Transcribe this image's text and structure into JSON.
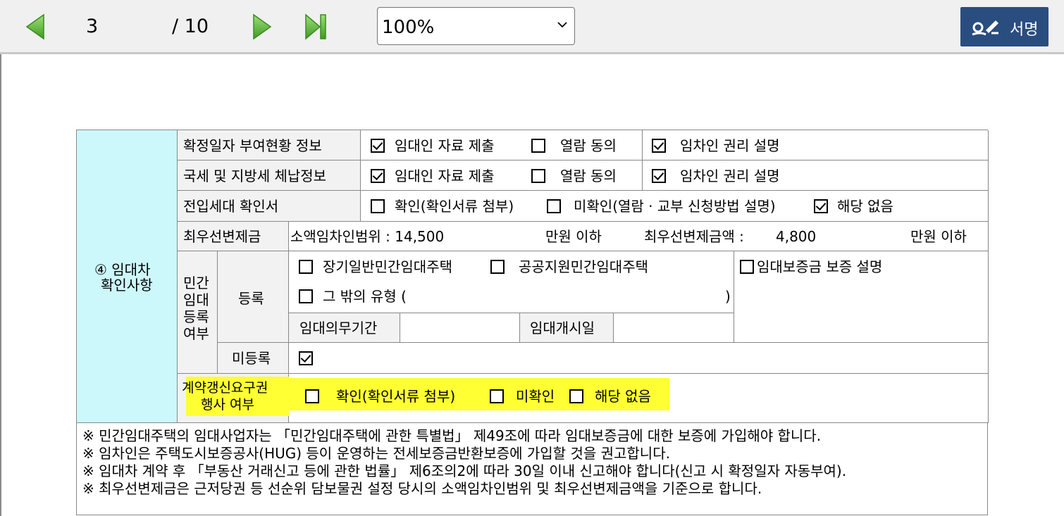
{
  "toolbar": {
    "prev_icon": "triangle-left-icon",
    "next_icon": "triangle-right-icon",
    "last_icon": "skip-last-icon",
    "current_page": "3",
    "total_pages": "/ 10",
    "zoom_value": "100%",
    "sign_label": "서명",
    "sign_icon": "signature-pen-icon",
    "colors": {
      "nav_green": "#6cc24a",
      "sign_bg": "#2a4d80"
    }
  },
  "form": {
    "section_title_line1": "④ 임대차",
    "section_title_line2": "확인사항",
    "section_color": "#ccf7fb",
    "row1": {
      "label": "확정일자 부여현황 정보",
      "opt1": "임대인 자료 제출",
      "opt1_checked": true,
      "opt2": "열람 동의",
      "opt2_checked": false,
      "opt3": "임차인 권리 설명",
      "opt3_checked": true
    },
    "row2": {
      "label": "국세 및 지방세 체납정보",
      "opt1": "임대인 자료 제출",
      "opt1_checked": true,
      "opt2": "열람 동의",
      "opt2_checked": false,
      "opt3": "임차인 권리 설명",
      "opt3_checked": true
    },
    "row3": {
      "label": "전입세대 확인서",
      "opt1": "확인(확인서류 첨부)",
      "opt1_checked": false,
      "opt2": "미확인(열람 · 교부 신청방법 설명)",
      "opt2_checked": false,
      "opt3": "해당 없음",
      "opt3_checked": true
    },
    "row4": {
      "label": "최우선변제금",
      "range_label": "소액임차인범위 : 14,500",
      "range_unit": "만원 이하",
      "amount_label": "최우선변제금액 :",
      "amount_value": "4,800",
      "amount_unit": "만원 이하"
    },
    "rental": {
      "label_lines": [
        "민간",
        "임대",
        "등록",
        "여부"
      ],
      "registered_label": "등록",
      "opt_long_term": "장기일반민간임대주택",
      "opt_long_term_checked": false,
      "opt_public": "공공지원민간임대주택",
      "opt_public_checked": false,
      "opt_other": "그 밖의 유형 (",
      "opt_other_close": ")",
      "opt_other_checked": false,
      "guarantee": "임대보증금 보증 설명",
      "guarantee_checked": false,
      "duty_period_label": "임대의무기간",
      "start_date_label": "임대개시일",
      "unregistered_label": "미등록",
      "unregistered_checked": true
    },
    "renewal": {
      "label_line1": "계약갱신요구권",
      "label_line2": "행사 여부",
      "opt1": "확인(확인서류 첨부)",
      "opt1_checked": false,
      "opt2": "미확인",
      "opt2_checked": false,
      "opt3": "해당 없음",
      "opt3_checked": false,
      "highlight_color": "#ffff33"
    },
    "notes": [
      "※ 민간임대주택의 임대사업자는 「민간임대주택에 관한 특별법」 제49조에 따라 임대보증금에 대한 보증에 가입해야 합니다.",
      "※ 임차인은 주택도시보증공사(HUG) 등이 운영하는 전세보증금반환보증에 가입할 것을 권고합니다.",
      "※ 임대차 계약 후 「부동산 거래신고 등에 관한 법률」 제6조의2에 따라 30일 이내 신고해야 합니다(신고 시 확정일자 자동부여).",
      "※ 최우선변제금은 근저당권 등 선순위 담보물권 설정 당시의 소액임차인범위 및 최우선변제금액을 기준으로 합니다."
    ]
  }
}
